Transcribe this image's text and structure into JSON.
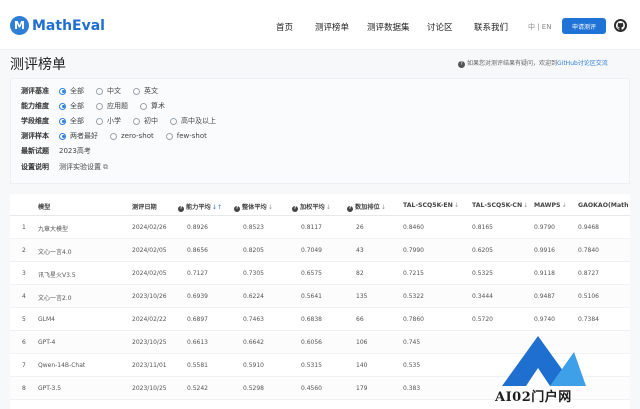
{
  "header": {
    "logo_mark": "M",
    "logo_text": "MathEval",
    "nav": [
      "首页",
      "测评榜单",
      "测评数据集",
      "讨论区",
      "联系我们"
    ],
    "lang": "中 | EN",
    "apply_button": "申请测评",
    "github_icon": "github-icon"
  },
  "page": {
    "title": "测评榜单",
    "notice_text": "如果您对测评结果有疑问，欢迎到",
    "notice_link": "GitHub讨论区交流"
  },
  "filters": {
    "rows": [
      {
        "label": "测评基准",
        "options": [
          "全部",
          "中文",
          "英文"
        ],
        "selected": 0
      },
      {
        "label": "能力维度",
        "options": [
          "全部",
          "应用题",
          "算术"
        ],
        "selected": 0
      },
      {
        "label": "学段维度",
        "options": [
          "全部",
          "小学",
          "初中",
          "高中及以上"
        ],
        "selected": 0
      },
      {
        "label": "测评样本",
        "options": [
          "两者最好",
          "zero-shot",
          "few-shot"
        ],
        "selected": 0
      }
    ],
    "latest_label": "最新试题",
    "latest_value": "2023高考",
    "settings_label": "设置说明",
    "settings_value": "测评实验设置"
  },
  "table": {
    "columns": [
      "",
      "模型",
      "测评日期",
      "能力平均",
      "整体平均",
      "加权平均",
      "数加排位",
      "TAL-SCQ5K-EN",
      "TAL-SCQ5K-CN",
      "MAWPS",
      "GAOKAO(Math"
    ],
    "rows": [
      [
        "1",
        "九章大模型",
        "2024/02/26",
        "0.8926",
        "0.8523",
        "0.8117",
        "26",
        "0.8460",
        "0.8165",
        "0.9790",
        "0.9468"
      ],
      [
        "2",
        "文心一言4.0",
        "2024/02/05",
        "0.8656",
        "0.8205",
        "0.7049",
        "43",
        "0.7990",
        "0.6205",
        "0.9916",
        "0.7840"
      ],
      [
        "3",
        "讯飞星火V3.5",
        "2024/02/05",
        "0.7127",
        "0.7305",
        "0.6575",
        "82",
        "0.7215",
        "0.5325",
        "0.9118",
        "0.8727"
      ],
      [
        "4",
        "文心一言2.0",
        "2023/10/26",
        "0.6939",
        "0.6224",
        "0.5641",
        "135",
        "0.5322",
        "0.3444",
        "0.9487",
        "0.5106"
      ],
      [
        "5",
        "GLM4",
        "2024/02/22",
        "0.6897",
        "0.7463",
        "0.6838",
        "66",
        "0.7860",
        "0.5720",
        "0.9740",
        "0.7384"
      ],
      [
        "6",
        "GPT-4",
        "2023/10/25",
        "0.6613",
        "0.6642",
        "0.6056",
        "106",
        "0.745",
        "",
        "",
        ""
      ],
      [
        "7",
        "Qwen-14B-Chat",
        "2023/11/01",
        "0.5581",
        "0.5910",
        "0.5315",
        "140",
        "0.535",
        "",
        "",
        ""
      ],
      [
        "8",
        "GPT-3.5",
        "2023/10/25",
        "0.5242",
        "0.5298",
        "0.4560",
        "179",
        "0.383",
        "",
        "",
        ""
      ]
    ]
  },
  "watermark": {
    "text": "AI02门户网"
  }
}
